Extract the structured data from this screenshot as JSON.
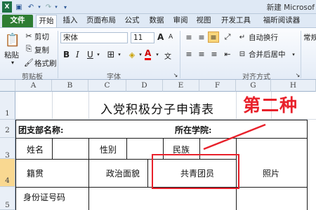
{
  "window": {
    "title": "新建 Microsof"
  },
  "ribbon_tabs": [
    "文件",
    "开始",
    "插入",
    "页面布局",
    "公式",
    "数据",
    "审阅",
    "视图",
    "开发工具",
    "福昕阅读器"
  ],
  "clipboard": {
    "paste": "粘贴",
    "cut": "剪切",
    "copy": "复制",
    "format_painter": "格式刷",
    "group": "剪贴板"
  },
  "font": {
    "name": "宋体",
    "size": "11",
    "bold": "B",
    "italic": "I",
    "underline": "U",
    "font_color_letter": "A",
    "grow": "A",
    "shrink": "A",
    "group": "字体"
  },
  "alignment": {
    "wrap": "自动换行",
    "merge": "合并后居中",
    "group": "对齐方式"
  },
  "number": {
    "format": "常规"
  },
  "columns": [
    "A",
    "B",
    "C",
    "D",
    "E",
    "F",
    "G",
    "H"
  ],
  "rows": [
    "1",
    "2",
    "3",
    "4",
    "5"
  ],
  "sheet": {
    "title": "入党积极分子申请表",
    "branch_label": "团支部名称:",
    "college_label": "所在学院:",
    "name_label": "姓名",
    "gender_label": "性别",
    "ethnicity_label": "民族",
    "origin_label": "籍贯",
    "political_label": "政治面貌",
    "political_value": "共青团员",
    "photo_label": "照片",
    "id_label": "身份证号码"
  },
  "annotation": {
    "text": "第二种",
    "color": "#e8212b"
  }
}
